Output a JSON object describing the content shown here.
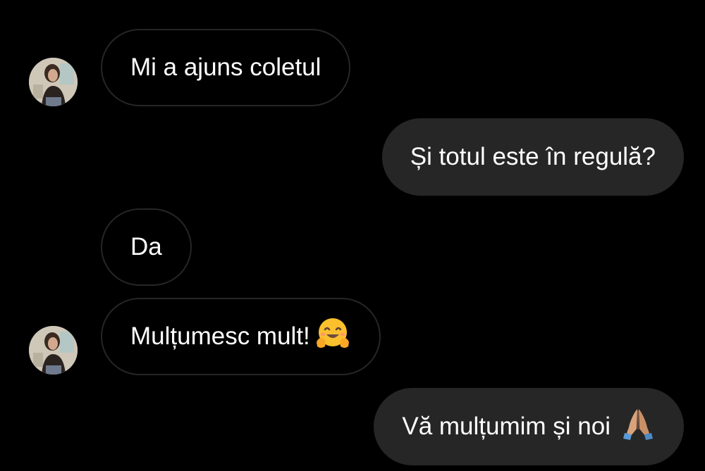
{
  "messages": [
    {
      "direction": "incoming",
      "text": "Mi a ajuns coletul",
      "avatar": true
    },
    {
      "direction": "outgoing",
      "text": "Și totul este în regulă?"
    },
    {
      "direction": "incoming",
      "text": "Da",
      "avatar": false
    },
    {
      "direction": "incoming",
      "text": "Mulțumesc mult!",
      "emoji": "hugging-face-icon",
      "avatar": true
    },
    {
      "direction": "outgoing",
      "text": "Vă mulțumim și noi",
      "emoji": "folded-hands-icon"
    }
  ],
  "colors": {
    "background": "#000000",
    "incoming_border": "#262626",
    "outgoing_fill": "#262626",
    "text": "#ffffff"
  }
}
